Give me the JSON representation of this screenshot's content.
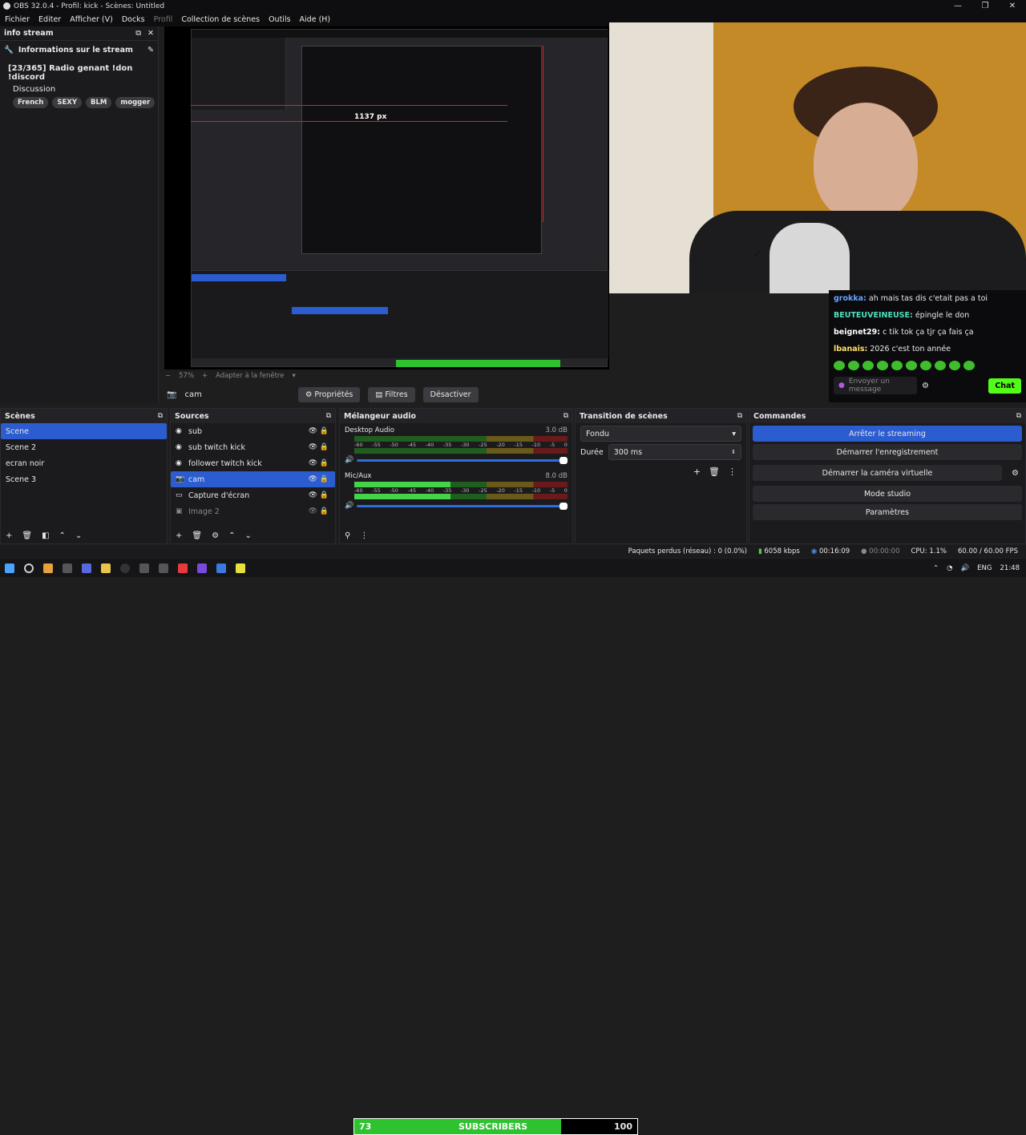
{
  "window": {
    "title": "OBS 32.0.4 - Profil: kick - Scènes: Untitled",
    "controls": [
      "—",
      "❐",
      "✕"
    ]
  },
  "menu": [
    "Fichier",
    "Editer",
    "Afficher (V)",
    "Docks",
    "Profil",
    "Collection de scènes",
    "Outils",
    "Aide (H)"
  ],
  "dock": {
    "title": "info stream",
    "header": "Informations sur le stream",
    "stream_title": "[23/365] Radio genant !don !discord",
    "category": "Discussion",
    "tags": [
      "French",
      "SEXY",
      "BLM",
      "mogger"
    ]
  },
  "preview": {
    "measure_label": "1137 px"
  },
  "chat": {
    "messages": [
      {
        "user": "grokka:",
        "text": "ah mais tas dis c'etait pas a toi"
      },
      {
        "user": "BEUTEUVEINEUSE:",
        "text": "épingle le don"
      },
      {
        "user": "beignet29:",
        "text": "c tik tok ça tjr ça fais ça"
      },
      {
        "user": "lbanais:",
        "text": "2026 c'est ton année"
      }
    ],
    "input_placeholder": "Envoyer un message",
    "send_label": "Chat",
    "accent": "#53fc18"
  },
  "zoom": {
    "level": "57%",
    "fit": "Adapter à la fenêtre"
  },
  "source_bar": {
    "name": "cam",
    "props": "Propriétés",
    "filters": "Filtres",
    "disable": "Désactiver"
  },
  "scenes": {
    "title": "Scènes",
    "items": [
      "Scene",
      "Scene 2",
      "ecran noir",
      "Scene 3"
    ],
    "selected": 0
  },
  "sources": {
    "title": "Sources",
    "items": [
      "sub",
      "sub twitch kick",
      "follower twitch kick",
      "cam",
      "Capture d'écran",
      "Image 2"
    ],
    "selected": 3
  },
  "mixer": {
    "title": "Mélangeur audio",
    "ticks": [
      "-60",
      "-55",
      "-50",
      "-45",
      "-40",
      "-35",
      "-30",
      "-25",
      "-20",
      "-15",
      "-10",
      "-5",
      "0"
    ],
    "channels": [
      {
        "name": "Desktop Audio",
        "db": "3.0 dB",
        "level": 0.0
      },
      {
        "name": "Mic/Aux",
        "db": "8.0 dB",
        "level": 0.45
      }
    ]
  },
  "transitions": {
    "title": "Transition de scènes",
    "selected": "Fondu",
    "duration_label": "Durée",
    "duration": "300 ms"
  },
  "commands": {
    "title": "Commandes",
    "buttons": [
      "Arrêter le streaming",
      "Démarrer l'enregistrement",
      "Démarrer la caméra virtuelle",
      "Mode studio",
      "Paramètres"
    ]
  },
  "status": {
    "dropped": "Paquets perdus (réseau) : 0 (0.0%)",
    "bitrate": "6058 kbps",
    "stream_time": "00:16:09",
    "rec_time": "00:00:00",
    "cpu": "CPU: 1.1%",
    "fps": "60.00 / 60.00 FPS"
  },
  "subscribers": {
    "current": "73",
    "label": "SUBSCRIBERS",
    "goal": "100",
    "fill_fraction": 0.73
  },
  "taskbar": {
    "lang": "ENG",
    "clock": "21:48"
  },
  "colors": {
    "accent": "#2b5cd0",
    "bar": "#2fc22f"
  }
}
